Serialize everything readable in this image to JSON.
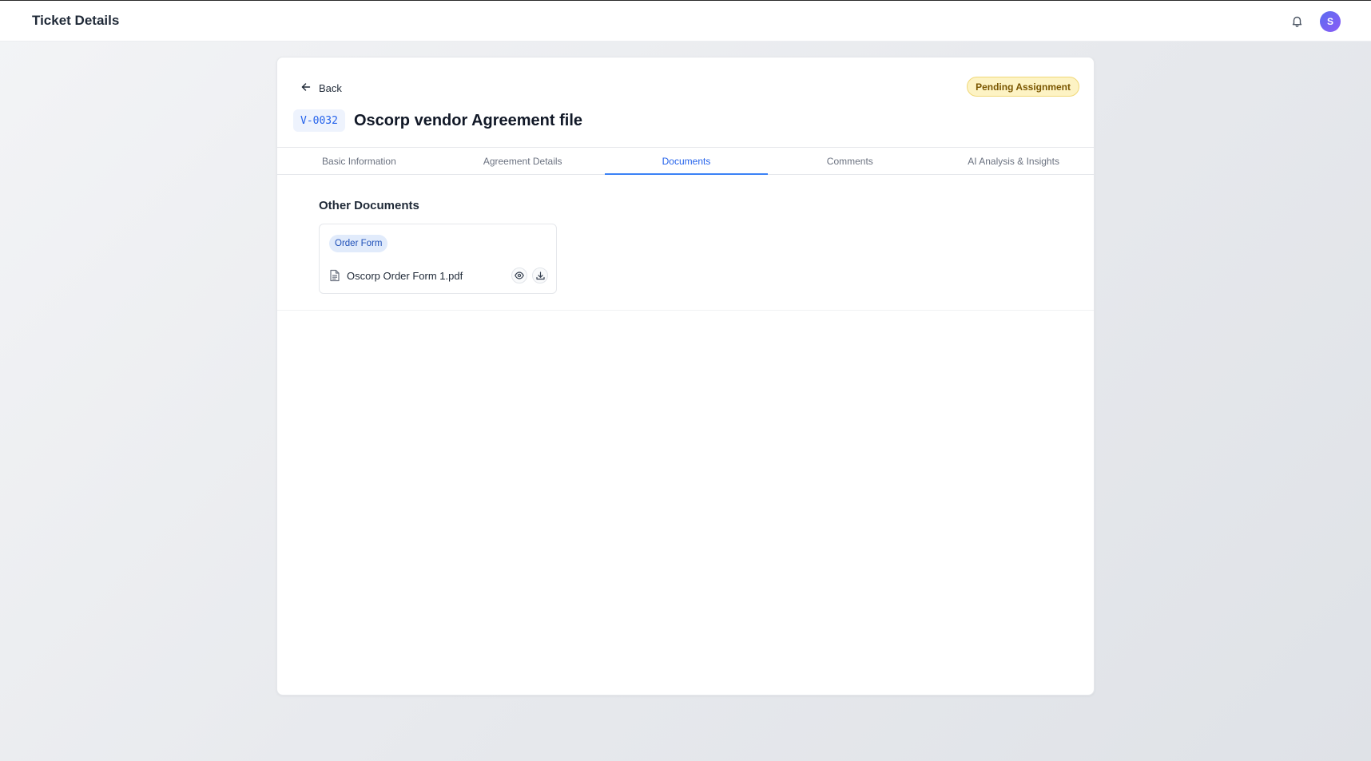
{
  "header": {
    "title": "Ticket Details",
    "avatar_initial": "S",
    "bell_icon": "bell-icon"
  },
  "ticket": {
    "back_label": "Back",
    "id": "V-0032",
    "title": "Oscorp vendor Agreement file",
    "status": "Pending Assignment",
    "status_color": "#fdf3c4"
  },
  "tabs": [
    {
      "label": "Basic Information",
      "active": false
    },
    {
      "label": "Agreement Details",
      "active": false
    },
    {
      "label": "Documents",
      "active": true
    },
    {
      "label": "Comments",
      "active": false
    },
    {
      "label": "AI Analysis & Insights",
      "active": false
    }
  ],
  "documents": {
    "section_title": "Other Documents",
    "items": [
      {
        "tag": "Order Form",
        "file_name": "Oscorp Order Form 1.pdf"
      }
    ]
  },
  "colors": {
    "accent": "#2563eb",
    "avatar": "#6366f1"
  }
}
